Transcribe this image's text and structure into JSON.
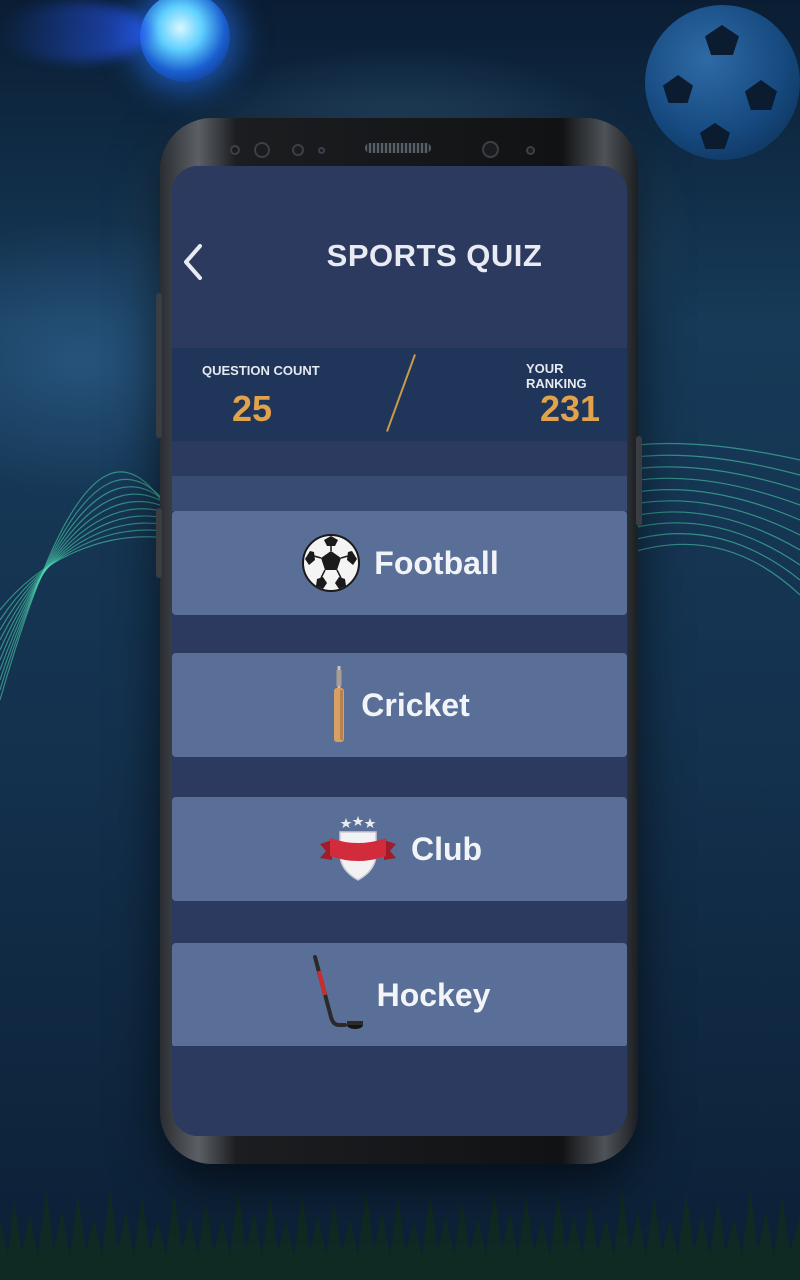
{
  "header": {
    "title": "SPORTS QUIZ",
    "back_icon": "chevron-left-icon"
  },
  "stats": {
    "question_count_label": "QUESTION COUNT",
    "question_count_value": "25",
    "ranking_label": "YOUR RANKING",
    "ranking_value": "231"
  },
  "categories": [
    {
      "label": "Football",
      "icon": "soccer-ball-icon"
    },
    {
      "label": "Cricket",
      "icon": "cricket-bat-icon"
    },
    {
      "label": "Club",
      "icon": "club-shield-icon"
    },
    {
      "label": "Hockey",
      "icon": "hockey-stick-icon"
    }
  ],
  "colors": {
    "accent": "#e0a24a",
    "screen_bg": "#2c3a5f",
    "card_bg": "#5a6f97",
    "stats_bg": "#1f3559"
  }
}
